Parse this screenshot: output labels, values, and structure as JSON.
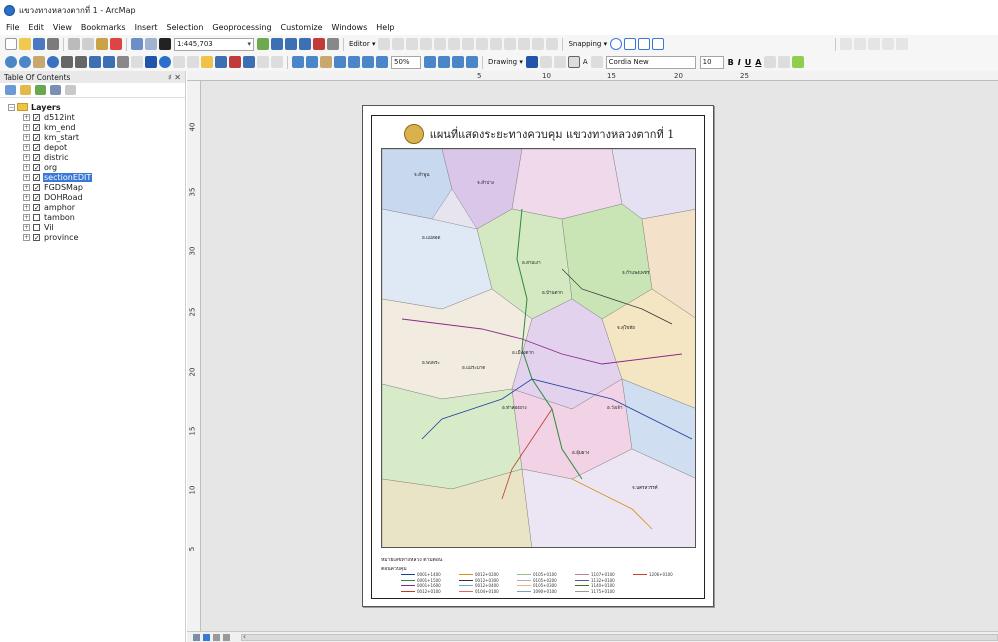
{
  "window": {
    "title": "แขวงทางหลวงตากที่ 1 - ArcMap"
  },
  "menu": [
    "File",
    "Edit",
    "View",
    "Bookmarks",
    "Insert",
    "Selection",
    "Geoprocessing",
    "Customize",
    "Windows",
    "Help"
  ],
  "toolbar": {
    "scale": "1:445,703",
    "editor_label": "Editor ▾",
    "snapping_label": "Snapping ▾",
    "zoom_percent": "50%",
    "drawing_label": "Drawing ▾",
    "font_name": "Cordia New",
    "font_size": "10",
    "bold": "B",
    "italic": "I",
    "underline": "U",
    "font_color_label": "A"
  },
  "toc": {
    "title": "Table Of Contents",
    "pin": "♯ ✕",
    "root_label": "Layers",
    "layers": [
      {
        "name": "d512int",
        "checked": true,
        "selected": false
      },
      {
        "name": "km_end",
        "checked": true,
        "selected": false
      },
      {
        "name": "km_start",
        "checked": true,
        "selected": false
      },
      {
        "name": "depot",
        "checked": true,
        "selected": false
      },
      {
        "name": "distric",
        "checked": true,
        "selected": false
      },
      {
        "name": "org",
        "checked": true,
        "selected": false
      },
      {
        "name": "sectionEDIT",
        "checked": true,
        "selected": true
      },
      {
        "name": "FGDSMap",
        "checked": true,
        "selected": false
      },
      {
        "name": "DOHRoad",
        "checked": true,
        "selected": false
      },
      {
        "name": "amphor",
        "checked": true,
        "selected": false
      },
      {
        "name": "tambon",
        "checked": false,
        "selected": false
      },
      {
        "name": "Vil",
        "checked": false,
        "selected": false
      },
      {
        "name": "province",
        "checked": true,
        "selected": false
      }
    ]
  },
  "rulers": {
    "top": [
      "5",
      "10",
      "15",
      "20",
      "25"
    ],
    "left": [
      "40",
      "35",
      "30",
      "25",
      "20",
      "15",
      "10",
      "5"
    ]
  },
  "layout": {
    "map_title": "แผนที่แสดงระยะทางควบคุม แขวงทางหลวงตากที่ 1",
    "legend_title": "หมายเลขทางหลวง ตามตอน",
    "legend_subtitle": "ตอนควบคุม",
    "legend_items": [
      "0001+1400",
      "0001+1500",
      "0001+1600",
      "0012+0100",
      "0012+0200",
      "0012+0300",
      "0012+0400",
      "0104+0100",
      "0105+0100",
      "0105+0200",
      "0105+0300",
      "1090+0100",
      "1107+0100",
      "1132+0100",
      "1140+0100",
      "1175+0100",
      "1206+0100"
    ],
    "labels": [
      "จ.ลำพูน",
      "จ.ลำปาง",
      "อ.แม่สอด",
      "อ.สามเงา",
      "อ.บ้านตาก",
      "อ.เมืองตาก",
      "อ.พบพระ",
      "อ.แม่ระมาด",
      "จ.กำแพงเพชร",
      "จ.สุโขทัย",
      "อ.ท่าสองยาง",
      "อ.วังเจ้า",
      "อ.อุ้มผาง",
      "จ.นครสวรรค์"
    ]
  },
  "colors": {
    "selection": "#3a78d8",
    "background": "#e6e6e6"
  }
}
